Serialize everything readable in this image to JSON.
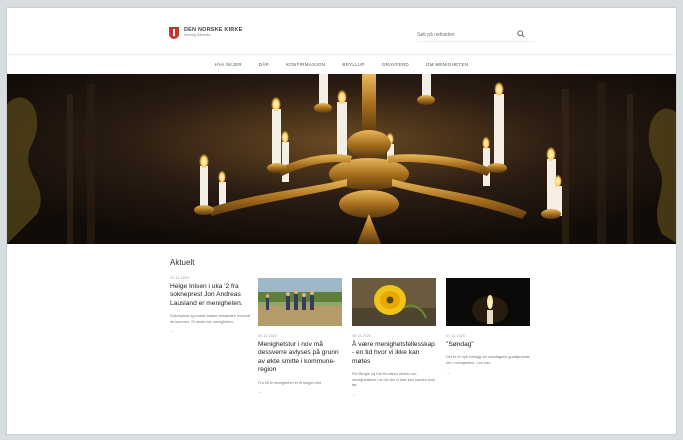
{
  "site": {
    "logo_title": "DEN NORSKE KIRKE",
    "logo_sub": "Kirkelig fellesråd"
  },
  "search": {
    "placeholder": "Søk på nettsiden"
  },
  "nav": {
    "items": [
      "HVA SKJER",
      "DÅP",
      "KONFIRMASJON",
      "BRYLLUP",
      "GRAVFERD",
      "OM MENIGHETEN"
    ]
  },
  "hero": {
    "alt": "Lysekrone med tente lys i kirken"
  },
  "news": {
    "section_title": "Aktuelt",
    "featured": {
      "date": "15.12.2020",
      "headline": "Helge Inlsen i uka '2 fra sokneprest Jon Andreas Lausland er menigheten.",
      "excerpt": "Sokneprest og koster hadde besøksleir hvorvidt de kommer. Til annet har menigheten.",
      "more": "→"
    },
    "cards": [
      {
        "date": "09.12.2020",
        "headline": "Menighetstur i nov må dessverre avlyses på grunn av økte smitte i kommune-region",
        "excerpt": "Fra 05 til menigheten er et klaget vårt.",
        "more": "→"
      },
      {
        "date": "08.12.2020",
        "headline": "Å være menighetsfellesskap - en tid hvor vi ikke kan møtes",
        "excerpt": "Per Bergle og Kai Knudsen skriver om menighetslivet i en tid der vi ikke kan samles som før.",
        "more": "→"
      },
      {
        "date": "07.12.2020",
        "headline": "\"Søndag\"",
        "excerpt": "Det er et nytt innlegg om søndagens gudstjeneste her i menigheten. Les mer.",
        "more": "→"
      }
    ]
  },
  "colors": {
    "brand": "#c0392b",
    "text": "#333333",
    "muted": "#888888"
  }
}
